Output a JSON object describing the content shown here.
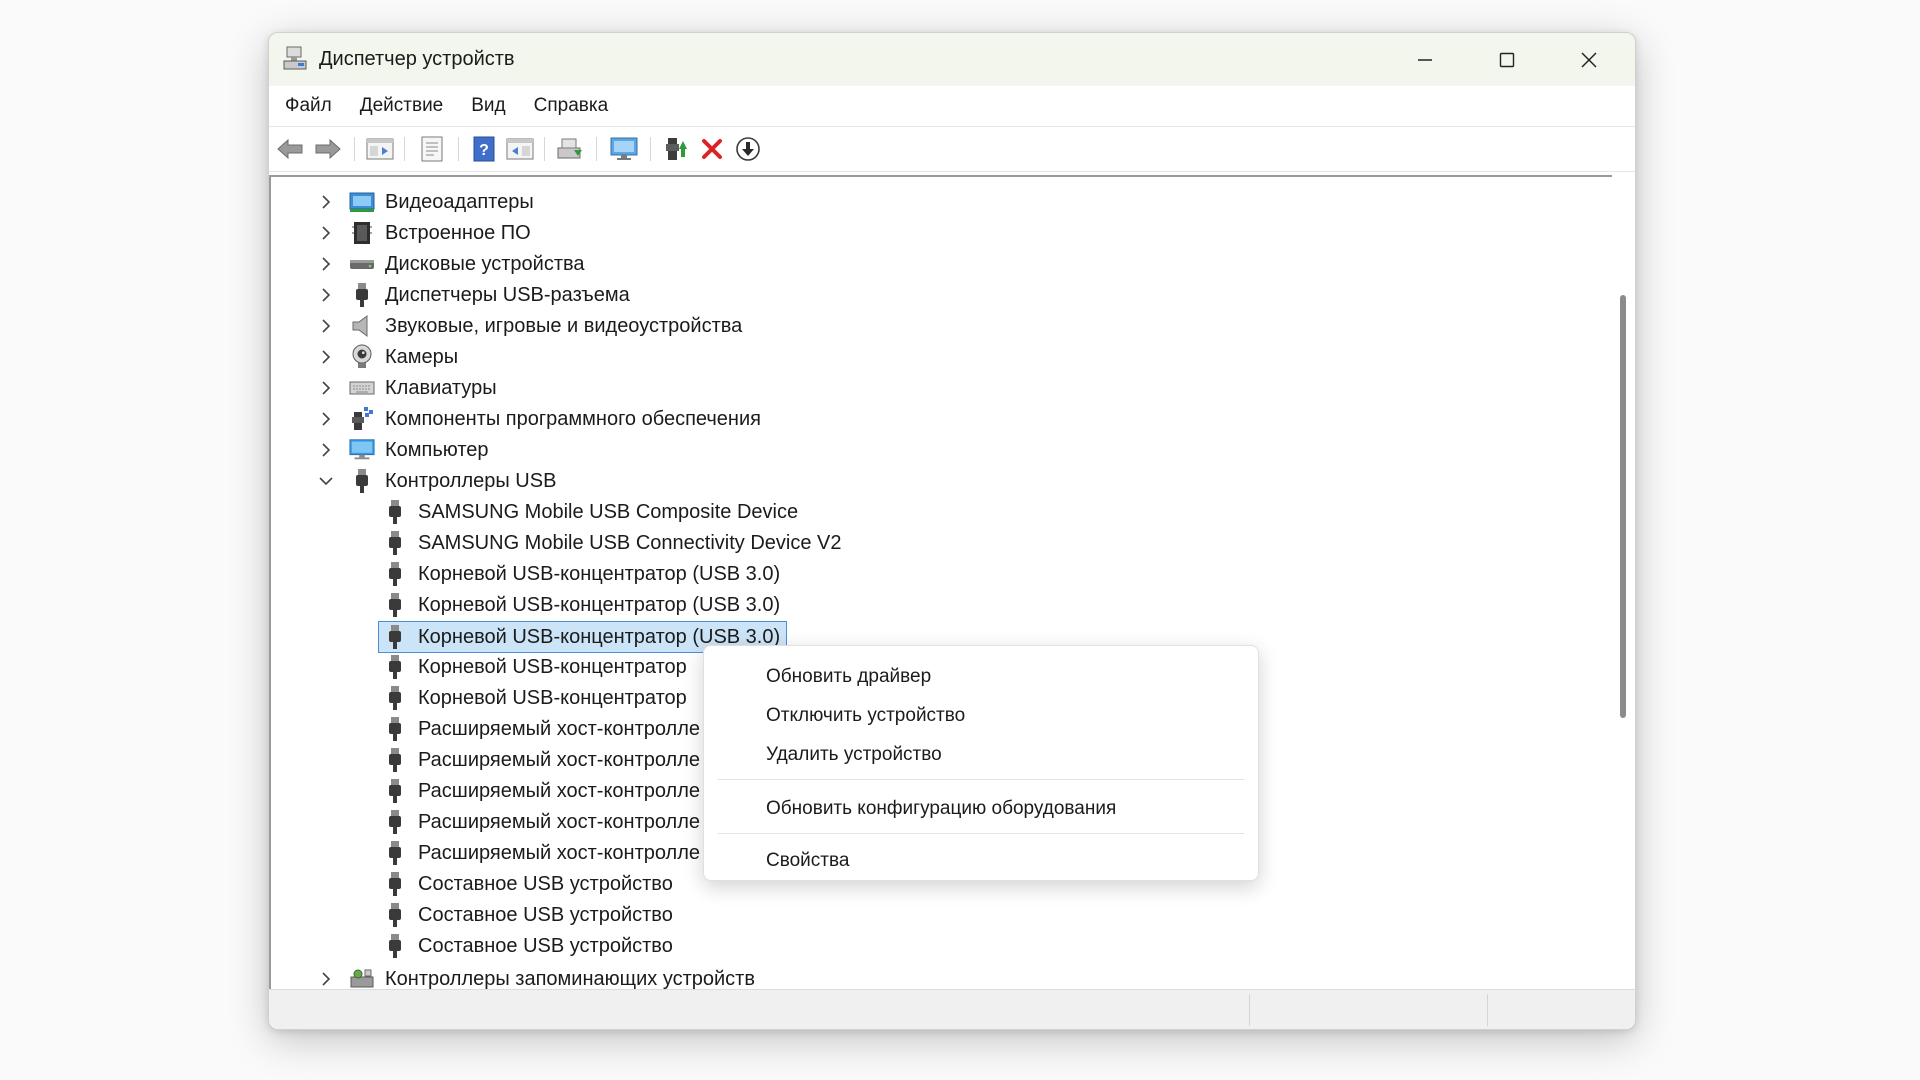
{
  "window": {
    "title": "Диспетчер устройств"
  },
  "menu": [
    "Файл",
    "Действие",
    "Вид",
    "Справка"
  ],
  "tree": {
    "categories_top": [
      {
        "label": "Видеоадаптеры",
        "icon": "display-adapter-icon"
      },
      {
        "label": "Встроенное ПО",
        "icon": "firmware-icon"
      },
      {
        "label": "Дисковые устройства",
        "icon": "disk-drive-icon"
      },
      {
        "label": "Диспетчеры USB-разъема",
        "icon": "usb-connector-icon"
      },
      {
        "label": "Звуковые, игровые и видеоустройства",
        "icon": "speaker-icon"
      },
      {
        "label": "Камеры",
        "icon": "camera-icon"
      },
      {
        "label": "Клавиатуры",
        "icon": "keyboard-icon"
      },
      {
        "label": "Компоненты программного обеспечения",
        "icon": "software-component-icon"
      },
      {
        "label": "Компьютер",
        "icon": "computer-icon"
      }
    ],
    "expanded": {
      "label": "Контроллеры USB",
      "icon": "usb-icon"
    },
    "children": [
      "SAMSUNG Mobile USB Composite Device",
      "SAMSUNG Mobile USB Connectivity Device V2",
      "Корневой USB-концентратор (USB 3.0)",
      "Корневой USB-концентратор (USB 3.0)",
      "Корневой USB-концентратор (USB 3.0)",
      "Корневой USB-концентратор",
      "Корневой USB-концентратор",
      "Расширяемый хост-контролле",
      "Расширяемый хост-контролле",
      "Расширяемый хост-контролле",
      "Расширяемый хост-контролле",
      "Расширяемый хост-контролле",
      "Составное USB устройство",
      "Составное USB устройство",
      "Составное USB устройство"
    ],
    "selected_index": 4,
    "next_category": {
      "label": "Контроллеры запоминающих устройств",
      "icon": "storage-controller-icon"
    }
  },
  "context_menu": {
    "update_driver": "Обновить драйвер",
    "disable_device": "Отключить устройство",
    "uninstall_device": "Удалить устройство",
    "scan_hardware": "Обновить конфигурацию оборудования",
    "properties": "Свойства"
  },
  "colors": {
    "selection": "#cce4f7",
    "selection_border": "#4a90d9",
    "title_bg": "#f2f6ec",
    "remove_red": "#d9252a"
  }
}
